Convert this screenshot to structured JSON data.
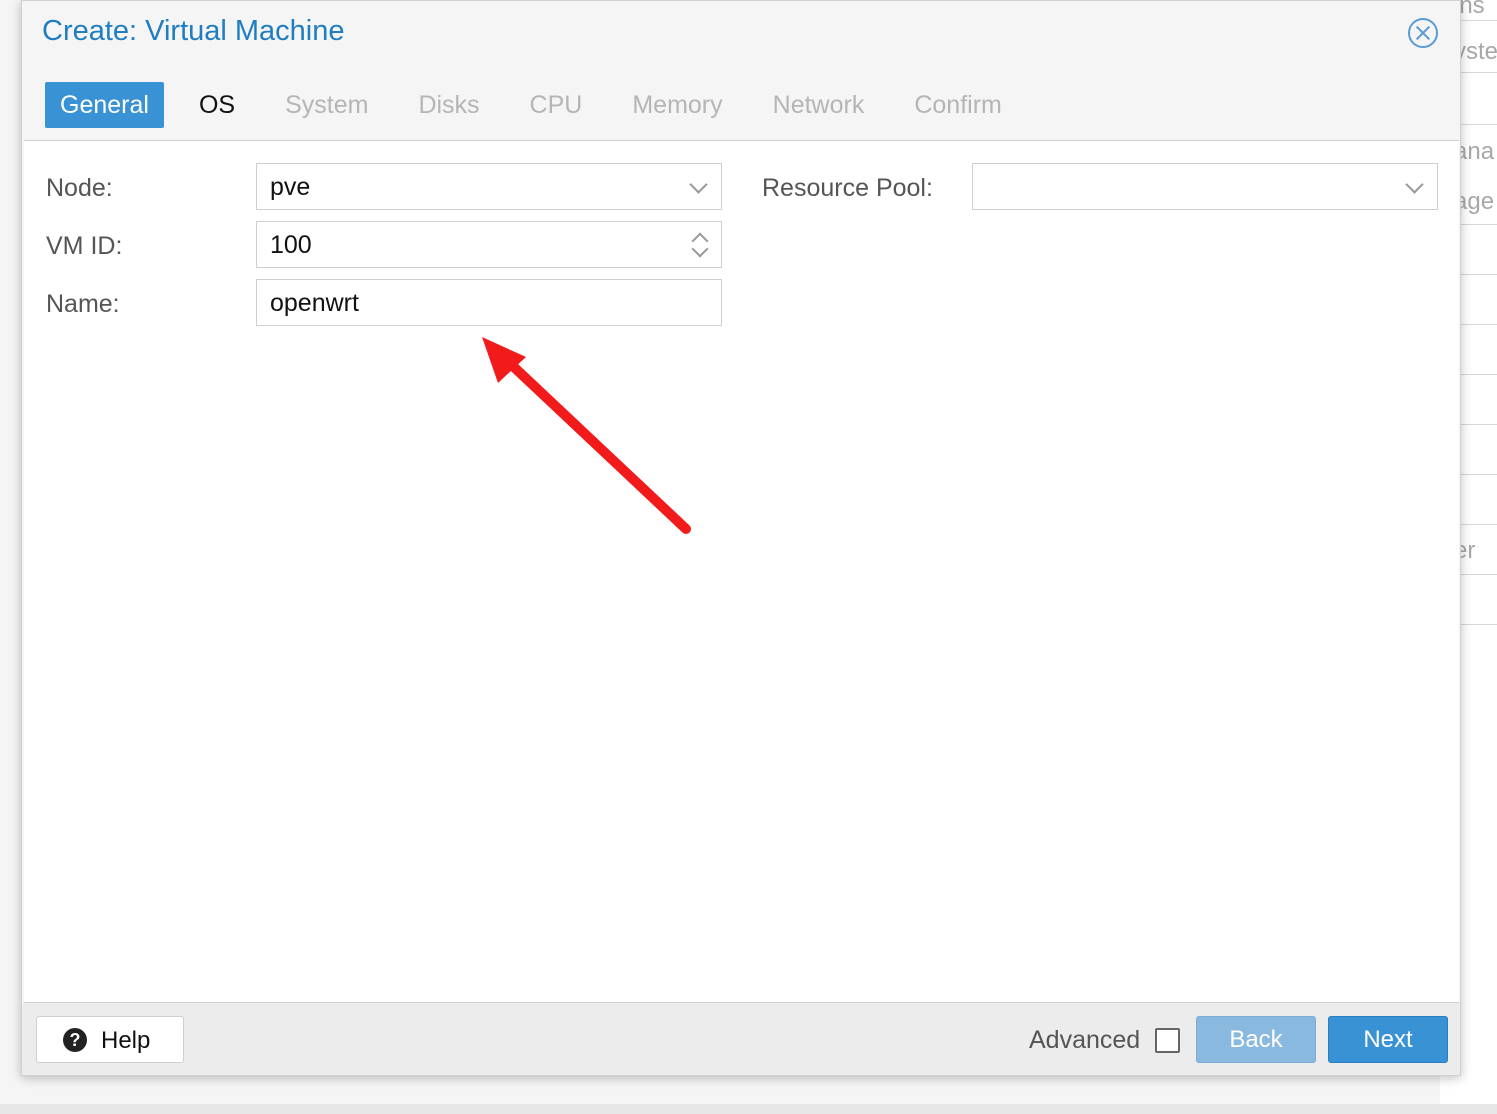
{
  "dialog": {
    "title": "Create: Virtual Machine"
  },
  "tabs": [
    {
      "label": "General",
      "state": "active"
    },
    {
      "label": "OS",
      "state": "enabled"
    },
    {
      "label": "System",
      "state": "disabled"
    },
    {
      "label": "Disks",
      "state": "disabled"
    },
    {
      "label": "CPU",
      "state": "disabled"
    },
    {
      "label": "Memory",
      "state": "disabled"
    },
    {
      "label": "Network",
      "state": "disabled"
    },
    {
      "label": "Confirm",
      "state": "disabled"
    }
  ],
  "form": {
    "node": {
      "label": "Node:",
      "value": "pve"
    },
    "vmid": {
      "label": "VM ID:",
      "value": "100"
    },
    "name": {
      "label": "Name:",
      "value": "openwrt"
    },
    "resource_pool": {
      "label": "Resource Pool:",
      "value": ""
    }
  },
  "footer": {
    "help_label": "Help",
    "advanced_label": "Advanced",
    "advanced_checked": false,
    "back_label": "Back",
    "next_label": "Next"
  },
  "background": {
    "fragments": [
      "ins",
      "yste",
      "ana",
      "age",
      "er"
    ]
  },
  "colors": {
    "accent": "#3892d4",
    "title": "#1f7dc1",
    "arrow": "#f21b1b"
  },
  "icons": {
    "close": "close-circle-icon",
    "help": "question-circle-icon",
    "dropdown": "chevron-down-icon",
    "spinner": "up-down-spinner-icon"
  }
}
